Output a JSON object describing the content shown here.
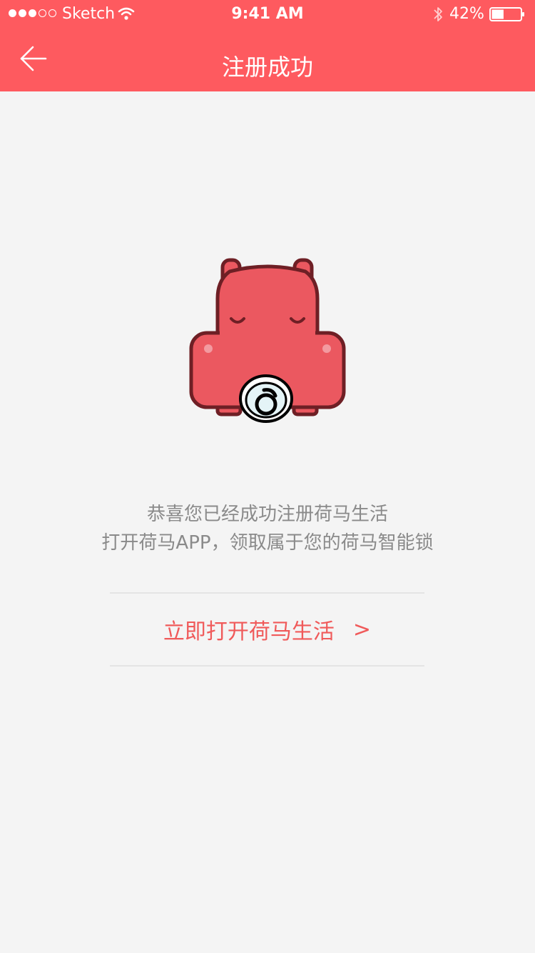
{
  "status_bar": {
    "carrier": "Sketch",
    "time": "9:41 AM",
    "battery_percent": "42%",
    "battery_level": 0.42
  },
  "header": {
    "title": "注册成功",
    "background": "#fe5a5f"
  },
  "message": {
    "line1": "恭喜您已经成功注册荷马生活",
    "line2": "打开荷马APP，领取属于您的荷马智能锁"
  },
  "action": {
    "label": "立即打开荷马生活",
    "chevron": ">",
    "color": "#f05a5a"
  },
  "icons": {
    "back": "arrow-left-icon",
    "mascot": "hippo-mascot-icon"
  }
}
